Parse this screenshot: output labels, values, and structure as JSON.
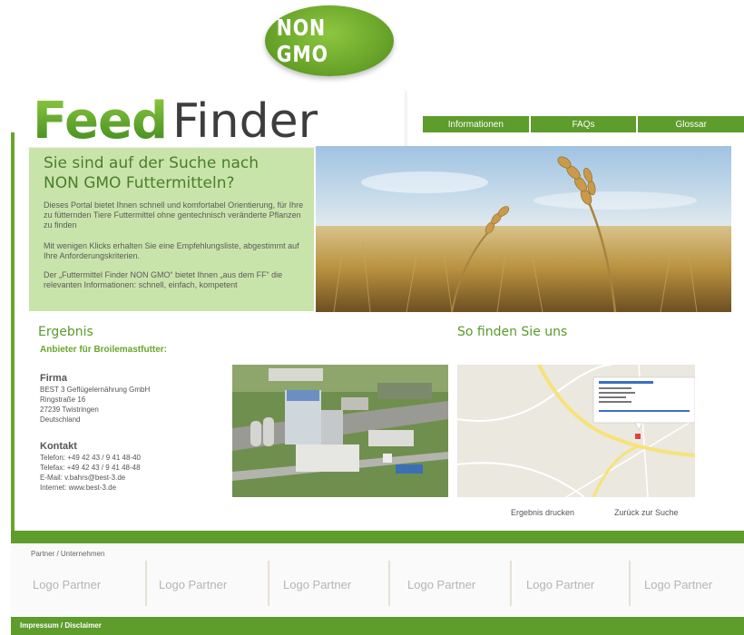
{
  "badge": {
    "text": "NON GMO"
  },
  "logo": {
    "feed": "Feed",
    "finder": "Finder"
  },
  "nav": {
    "items": [
      "Informationen",
      "FAQs",
      "Glossar"
    ]
  },
  "hero": {
    "heading_line1": "Sie sind auf der Suche nach",
    "heading_line2": "NON GMO Futtermitteln?",
    "para1": "Dieses Portal bietet Ihnen schnell und komfortabel Orientierung, für Ihre zu fütternden Tiere Futtermittel ohne gentechnisch veränderte Pflanzen zu finden",
    "para2": "Mit wenigen Klicks erhalten Sie eine Empfehlungsliste, abgestimmt auf Ihre Anforderungskriterien.",
    "para3": "Der „Futtermittel Finder NON GMO“ bietet Ihnen „aus dem FF“ die relevanten Informationen: schnell, einfach, kompetent"
  },
  "result": {
    "heading": "Ergebnis",
    "subheading": "Anbieter für Broilemastfutter:",
    "firma_label": "Firma",
    "company": "BEST 3 Geflügelernährung GmbH",
    "street": "Ringstraße 16",
    "city": "27239 Twistringen",
    "country": "Deutschland",
    "kontakt_label": "Kontakt",
    "phone": "Telefon: +49 42 43 / 9 41 48-40",
    "fax": "Telefax: +49 42 43 / 9 41 48-48",
    "email": "E-Mail: v.bahrs@best-3.de",
    "internet": "Internet: www.best-3.de"
  },
  "map": {
    "heading": "So finden Sie uns",
    "popup_title": "BEST 3 Geflügelernährung GmbH"
  },
  "actions": {
    "print": "Ergebnis drucken",
    "back": "Zurück zur Suche"
  },
  "partners": {
    "label": "Partner / Unternehmen",
    "logos": [
      "Logo Partner",
      "Logo Partner",
      "Logo Partner",
      "Logo Partner",
      "Logo Partner",
      "Logo Partner"
    ]
  },
  "footer": {
    "impressum": "Impressum / Disclaimer"
  },
  "colors": {
    "brand_green": "#5e9c2c",
    "light_green": "#c9e4ab",
    "heading_green": "#5a9a2b"
  }
}
